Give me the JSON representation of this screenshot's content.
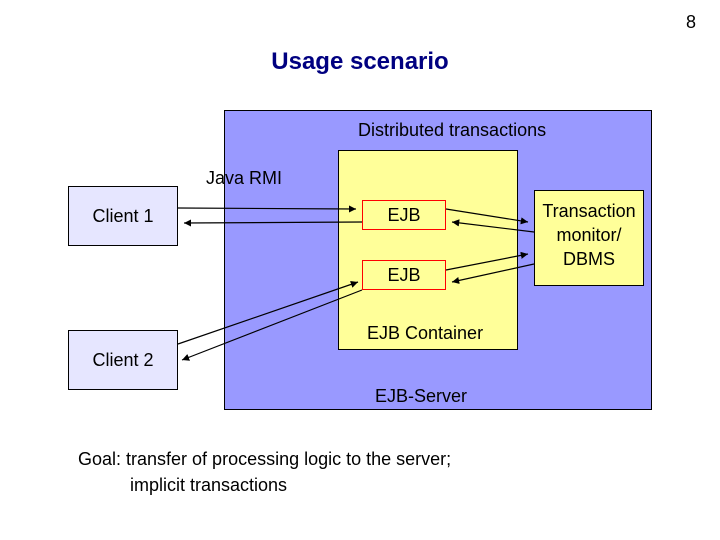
{
  "page_number": "8",
  "title": "Usage scenario",
  "client1": "Client 1",
  "client2": "Client 2",
  "rmi": "Java RMI",
  "distributed": "Distributed transactions",
  "ejb": "EJB",
  "container": "EJB Container",
  "server": "EJB-Server",
  "tm_line1": "Transaction",
  "tm_line2": "monitor/",
  "tm_line3": "DBMS",
  "goal_line1": "Goal:   transfer of processing logic to the server;",
  "goal_line2": "implicit transactions"
}
